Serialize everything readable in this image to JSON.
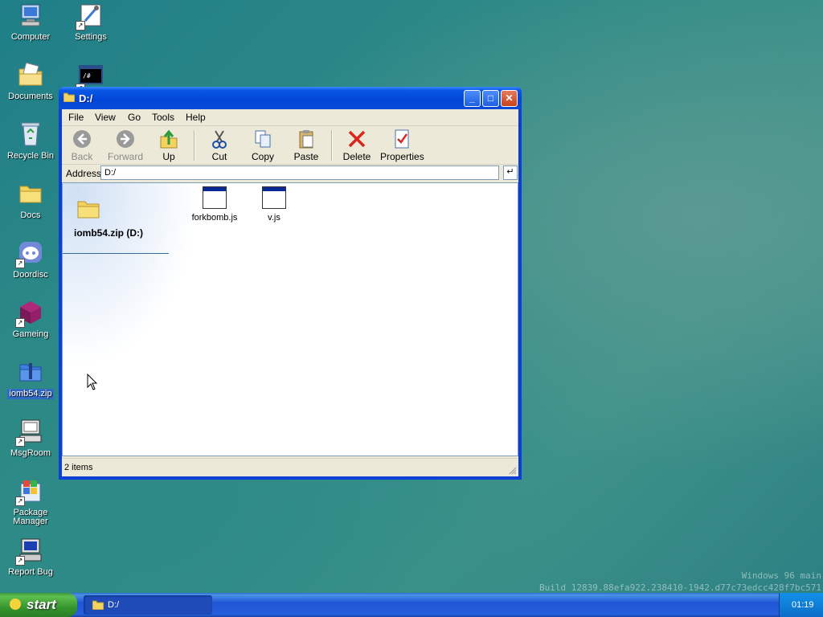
{
  "desktop": {
    "icons": [
      {
        "label": "Computer",
        "icon": "computer-icon"
      },
      {
        "label": "Settings",
        "icon": "settings-icon"
      },
      {
        "label": "Documents",
        "icon": "documents-icon"
      },
      {
        "label": "Recycle Bin",
        "icon": "recycle-bin-icon"
      },
      {
        "label": "Docs",
        "icon": "folder-icon"
      },
      {
        "label": "Doordisc",
        "icon": "discord-icon"
      },
      {
        "label": "Gameing",
        "icon": "cube-icon"
      },
      {
        "label": "iomb54.zip",
        "icon": "zip-icon"
      },
      {
        "label": "MsgRoom",
        "icon": "msgroom-icon"
      },
      {
        "label": "Package Manager",
        "icon": "package-icon"
      },
      {
        "label": "Report Bug",
        "icon": "report-bug-icon"
      },
      {
        "label": "",
        "icon": "terminal-icon"
      }
    ],
    "selected_label": "iomb54.zip"
  },
  "window": {
    "title": "D:/",
    "menu": [
      "File",
      "View",
      "Go",
      "Tools",
      "Help"
    ],
    "toolbar": {
      "back": "Back",
      "forward": "Forward",
      "up": "Up",
      "cut": "Cut",
      "copy": "Copy",
      "paste": "Paste",
      "delete": "Delete",
      "properties": "Properties"
    },
    "address_label": "Address",
    "address_value": "D:/",
    "go_glyph": "↵",
    "drive_label": "iomb54.zip (D:)",
    "files": [
      {
        "name": "forkbomb.js",
        "icon": "js-file-icon"
      },
      {
        "name": "v.js",
        "icon": "js-file-icon"
      }
    ],
    "status": "2 items"
  },
  "taskbar": {
    "start_label": "start",
    "task_label": "D:/",
    "clock": "01:19"
  },
  "build": {
    "line1": "Windows 96 main",
    "line2": "Build 12839.88efa922.238410-1942.d77c73edcc428f7bc571"
  },
  "colors": {
    "titlebar": "#0a58e8",
    "taskbar": "#245edb",
    "start": "#36962e",
    "selection": "#316ac5"
  }
}
